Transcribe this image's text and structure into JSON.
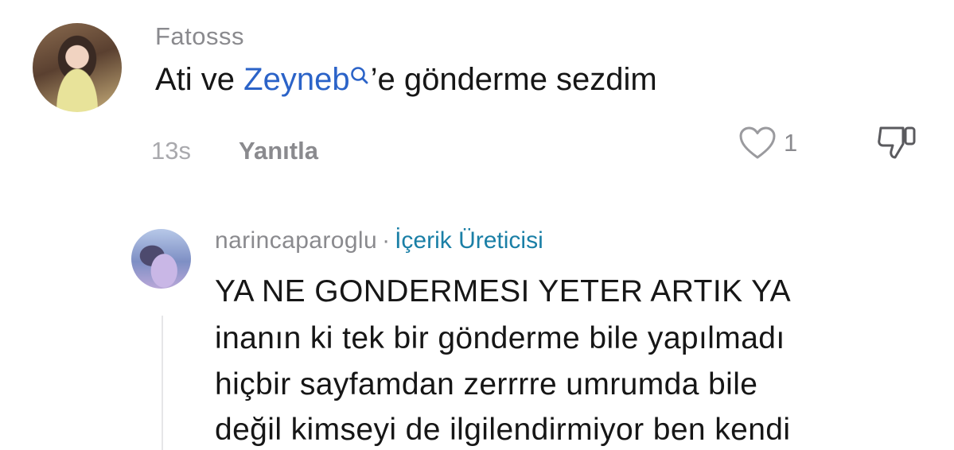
{
  "comment": {
    "username": "Fatosss",
    "text_before": "Ati ve ",
    "mention": "Zeyneb",
    "text_after": "’e gönderme sezdim",
    "time": "13s",
    "reply_label": "Yanıtla",
    "like_count": "1"
  },
  "reply": {
    "username": "narincaparoglu",
    "separator": "·",
    "badge": "İçerik Üreticisi",
    "lines": [
      "YA NE GONDERMESI YETER ARTIK YA",
      "inanın ki tek bir gönderme bile yapılmadı",
      "hiçbir sayfamdan zerrrre umrumda bile",
      "değil kimseyi de ilgilendirmiyor ben kendi"
    ]
  },
  "colors": {
    "mention": "#2b63c8",
    "badge": "#1a7fa6",
    "muted": "#8a8a8e",
    "text": "#161616"
  },
  "icons": [
    "search-icon",
    "heart-icon",
    "dislike-icon"
  ]
}
